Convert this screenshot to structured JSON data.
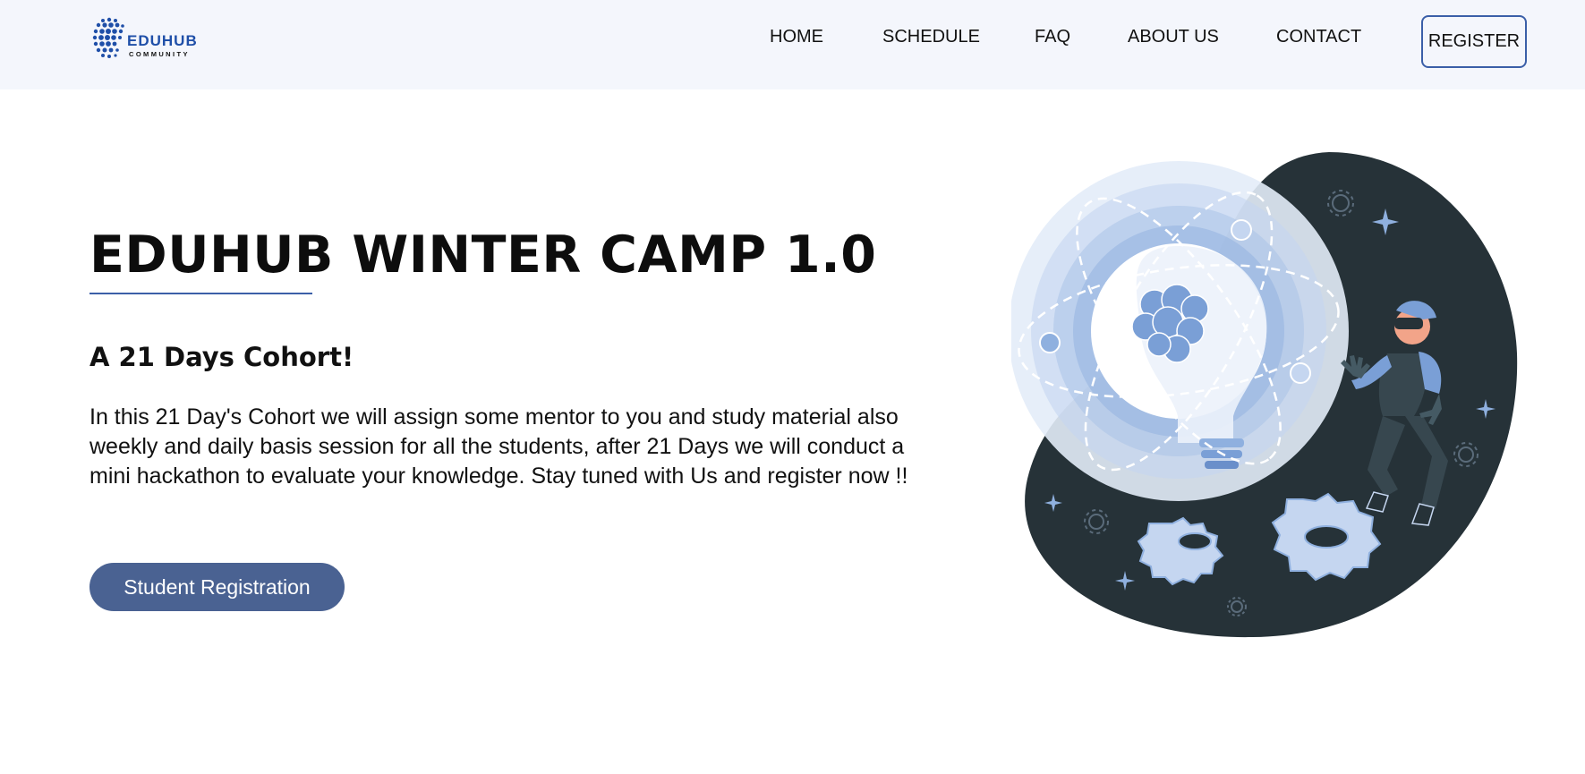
{
  "brand": {
    "name": "EDUHUB",
    "subtitle": "COMMUNITY",
    "logo_icon": "dotted-globe-icon",
    "color": "#1f4fa8"
  },
  "nav": {
    "items": [
      {
        "label": "HOME"
      },
      {
        "label": "SCHEDULE"
      },
      {
        "label": "FAQ"
      },
      {
        "label": "ABOUT US"
      },
      {
        "label": "CONTACT"
      }
    ],
    "register_label": "REGISTER"
  },
  "hero": {
    "title": "EDUHUB WINTER CAMP 1.0",
    "subtitle": "A 21 Days Cohort!",
    "description": "In this 21 Day's Cohort we will assign some mentor to you and study material also weekly and daily basis session for all the students, after 21 Days we will conduct a mini hackathon to evaluate your knowledge. Stay tuned with Us and register now !!",
    "cta_label": "Student Registration",
    "illustration": "lightbulb-vr-person-gears-illustration"
  },
  "colors": {
    "accent": "#3b5fa8",
    "cta_bg": "#4a6292",
    "navbar_bg": "#f4f6fc",
    "illustration_dark": "#263238",
    "illustration_light": "#c5d6f0"
  }
}
